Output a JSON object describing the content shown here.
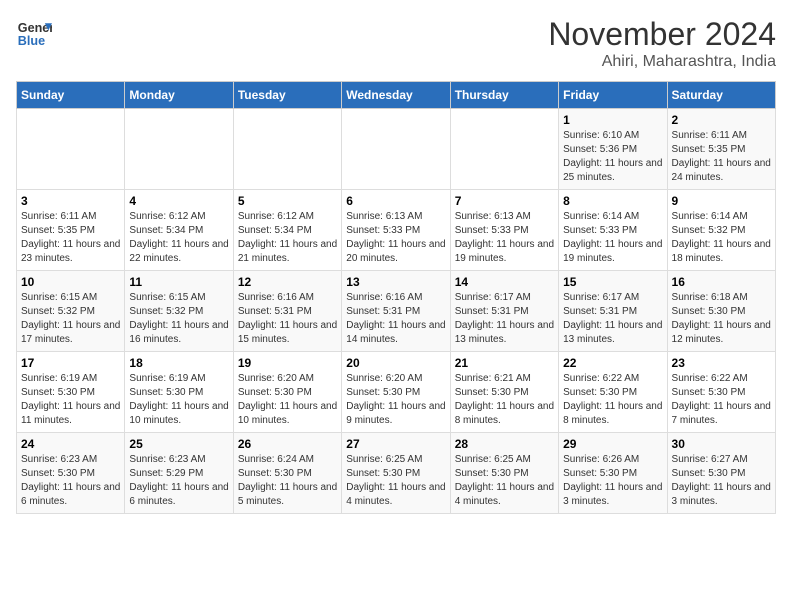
{
  "header": {
    "logo_line1": "General",
    "logo_line2": "Blue",
    "month": "November 2024",
    "location": "Ahiri, Maharashtra, India"
  },
  "weekdays": [
    "Sunday",
    "Monday",
    "Tuesday",
    "Wednesday",
    "Thursday",
    "Friday",
    "Saturday"
  ],
  "weeks": [
    [
      {
        "day": "",
        "info": ""
      },
      {
        "day": "",
        "info": ""
      },
      {
        "day": "",
        "info": ""
      },
      {
        "day": "",
        "info": ""
      },
      {
        "day": "",
        "info": ""
      },
      {
        "day": "1",
        "info": "Sunrise: 6:10 AM\nSunset: 5:36 PM\nDaylight: 11 hours and 25 minutes."
      },
      {
        "day": "2",
        "info": "Sunrise: 6:11 AM\nSunset: 5:35 PM\nDaylight: 11 hours and 24 minutes."
      }
    ],
    [
      {
        "day": "3",
        "info": "Sunrise: 6:11 AM\nSunset: 5:35 PM\nDaylight: 11 hours and 23 minutes."
      },
      {
        "day": "4",
        "info": "Sunrise: 6:12 AM\nSunset: 5:34 PM\nDaylight: 11 hours and 22 minutes."
      },
      {
        "day": "5",
        "info": "Sunrise: 6:12 AM\nSunset: 5:34 PM\nDaylight: 11 hours and 21 minutes."
      },
      {
        "day": "6",
        "info": "Sunrise: 6:13 AM\nSunset: 5:33 PM\nDaylight: 11 hours and 20 minutes."
      },
      {
        "day": "7",
        "info": "Sunrise: 6:13 AM\nSunset: 5:33 PM\nDaylight: 11 hours and 19 minutes."
      },
      {
        "day": "8",
        "info": "Sunrise: 6:14 AM\nSunset: 5:33 PM\nDaylight: 11 hours and 19 minutes."
      },
      {
        "day": "9",
        "info": "Sunrise: 6:14 AM\nSunset: 5:32 PM\nDaylight: 11 hours and 18 minutes."
      }
    ],
    [
      {
        "day": "10",
        "info": "Sunrise: 6:15 AM\nSunset: 5:32 PM\nDaylight: 11 hours and 17 minutes."
      },
      {
        "day": "11",
        "info": "Sunrise: 6:15 AM\nSunset: 5:32 PM\nDaylight: 11 hours and 16 minutes."
      },
      {
        "day": "12",
        "info": "Sunrise: 6:16 AM\nSunset: 5:31 PM\nDaylight: 11 hours and 15 minutes."
      },
      {
        "day": "13",
        "info": "Sunrise: 6:16 AM\nSunset: 5:31 PM\nDaylight: 11 hours and 14 minutes."
      },
      {
        "day": "14",
        "info": "Sunrise: 6:17 AM\nSunset: 5:31 PM\nDaylight: 11 hours and 13 minutes."
      },
      {
        "day": "15",
        "info": "Sunrise: 6:17 AM\nSunset: 5:31 PM\nDaylight: 11 hours and 13 minutes."
      },
      {
        "day": "16",
        "info": "Sunrise: 6:18 AM\nSunset: 5:30 PM\nDaylight: 11 hours and 12 minutes."
      }
    ],
    [
      {
        "day": "17",
        "info": "Sunrise: 6:19 AM\nSunset: 5:30 PM\nDaylight: 11 hours and 11 minutes."
      },
      {
        "day": "18",
        "info": "Sunrise: 6:19 AM\nSunset: 5:30 PM\nDaylight: 11 hours and 10 minutes."
      },
      {
        "day": "19",
        "info": "Sunrise: 6:20 AM\nSunset: 5:30 PM\nDaylight: 11 hours and 10 minutes."
      },
      {
        "day": "20",
        "info": "Sunrise: 6:20 AM\nSunset: 5:30 PM\nDaylight: 11 hours and 9 minutes."
      },
      {
        "day": "21",
        "info": "Sunrise: 6:21 AM\nSunset: 5:30 PM\nDaylight: 11 hours and 8 minutes."
      },
      {
        "day": "22",
        "info": "Sunrise: 6:22 AM\nSunset: 5:30 PM\nDaylight: 11 hours and 8 minutes."
      },
      {
        "day": "23",
        "info": "Sunrise: 6:22 AM\nSunset: 5:30 PM\nDaylight: 11 hours and 7 minutes."
      }
    ],
    [
      {
        "day": "24",
        "info": "Sunrise: 6:23 AM\nSunset: 5:30 PM\nDaylight: 11 hours and 6 minutes."
      },
      {
        "day": "25",
        "info": "Sunrise: 6:23 AM\nSunset: 5:29 PM\nDaylight: 11 hours and 6 minutes."
      },
      {
        "day": "26",
        "info": "Sunrise: 6:24 AM\nSunset: 5:30 PM\nDaylight: 11 hours and 5 minutes."
      },
      {
        "day": "27",
        "info": "Sunrise: 6:25 AM\nSunset: 5:30 PM\nDaylight: 11 hours and 4 minutes."
      },
      {
        "day": "28",
        "info": "Sunrise: 6:25 AM\nSunset: 5:30 PM\nDaylight: 11 hours and 4 minutes."
      },
      {
        "day": "29",
        "info": "Sunrise: 6:26 AM\nSunset: 5:30 PM\nDaylight: 11 hours and 3 minutes."
      },
      {
        "day": "30",
        "info": "Sunrise: 6:27 AM\nSunset: 5:30 PM\nDaylight: 11 hours and 3 minutes."
      }
    ]
  ]
}
